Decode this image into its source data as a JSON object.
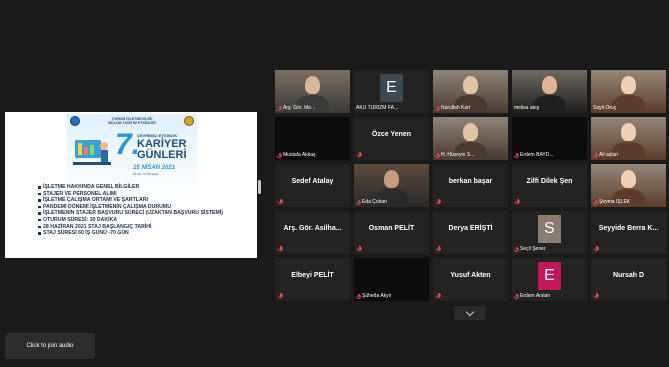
{
  "slide": {
    "header_line1": "TURİZM İŞLETMECİLİĞİ",
    "header_line2": "BÖLÜM TANITIM ETKİNLİĞİ",
    "big_number": "7.",
    "subtitle": "ÇEVRİMİÇİ ETKİNLİK",
    "title_line1": "KARİYER",
    "title_line2": "GÜNLERİ",
    "date": "15 NİSAN 2021",
    "date_note": "14.00 - 17.00 arası",
    "bullets": [
      "İŞLETME HAKKINDA GENEL BİLGİLER",
      "STAJER VE PERSONEL ALIMI",
      "İŞLETME ÇALIŞMA ORTAMI VE ŞARTLARI",
      "PANDEMİ DÖNEMİ İŞLETMENİN ÇALIŞMA DURUMU",
      "İŞLETMENİN STAJER BAŞVURU SÜRECİ (UZAKTAN BAŞVURU SİSTEMİ)",
      "OTURUM SÜRESİ: 30 DAKİKA",
      "28 HAZİRAN 2021 STAJ BAŞLANGIÇ TARİHİ",
      "STAJ SÜRESİ 60 İŞ GÜNÜ -70 GÜN"
    ]
  },
  "participants": [
    {
      "label": "Arş. Gör. Me...",
      "type": "video",
      "muted": true
    },
    {
      "label": "AKÜ TURİZM FA...",
      "type": "initial",
      "initial": "E",
      "bg": "#3a4a55",
      "muted": false
    },
    {
      "label": "Nurullah Kart",
      "type": "video",
      "muted": true
    },
    {
      "label": "melisa ateş",
      "type": "video",
      "muted": false,
      "highlight": true
    },
    {
      "label": "Sayit Oruç",
      "type": "video",
      "muted": false
    },
    {
      "label": "Mustafa Akkaş",
      "type": "video-dark",
      "muted": true
    },
    {
      "name": "Özce Yenen",
      "type": "name",
      "muted": true
    },
    {
      "label": "H. Hüseyin S...",
      "type": "video",
      "muted": true
    },
    {
      "label": "Erdem BAYD...",
      "type": "video-dark",
      "muted": true
    },
    {
      "label": "Ali aslan",
      "type": "video",
      "muted": true
    },
    {
      "name": "Sedef Atalay",
      "type": "name",
      "muted": true
    },
    {
      "label": "Eda Çoban",
      "type": "video",
      "muted": true
    },
    {
      "name": "berkan başar",
      "type": "name",
      "muted": true
    },
    {
      "name": "Zilfi Dilek Şen",
      "type": "name",
      "muted": true
    },
    {
      "label": "Şeyma İŞLEK",
      "type": "video",
      "muted": true
    },
    {
      "name": "Arş. Gör. Asilha...",
      "type": "name",
      "muted": true
    },
    {
      "name": "Osman PELİT",
      "type": "name",
      "muted": true
    },
    {
      "name": "Derya ERİŞTİ",
      "type": "name",
      "muted": true
    },
    {
      "label": "Seçil Şener",
      "type": "initial",
      "initial": "S",
      "bg": "#8a7b6e",
      "muted": true
    },
    {
      "name": "Seyyide Berra K...",
      "type": "name",
      "muted": true
    },
    {
      "name": "Elbeyi PELİT",
      "type": "name",
      "muted": true
    },
    {
      "label": "Şüheda Akyıl",
      "type": "video-dark",
      "muted": true
    },
    {
      "name": "Yusuf Akten",
      "type": "name",
      "muted": true
    },
    {
      "label": "Erdem Arslan",
      "type": "initial",
      "initial": "E",
      "bg": "#c2185b",
      "muted": true
    },
    {
      "name": "Nursah D",
      "type": "name",
      "muted": true
    }
  ],
  "controls": {
    "join_audio": "Click to join audio"
  }
}
